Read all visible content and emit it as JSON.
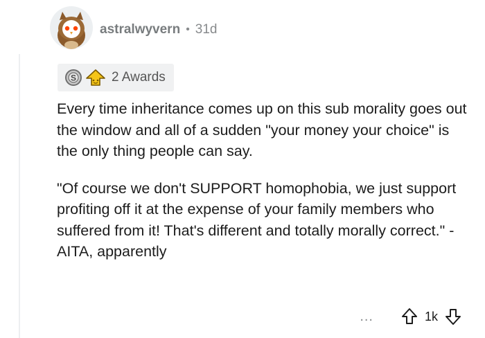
{
  "comment": {
    "author": "astralwyvern",
    "separator": "•",
    "age": "31d",
    "awards_label": "2 Awards",
    "paragraphs": [
      "Every time inheritance comes up on this sub morality goes out the window and all of a sudden \"your money your choice\" is the only thing people can say.",
      "\"Of course we don't SUPPORT homophobia, we just support profiting off it at the expense of your family members who suffered from it! That's different and totally morally correct.\" - AITA, apparently"
    ],
    "score": "1k",
    "more_label": "..."
  },
  "icons": {
    "avatar": "owl-avatar",
    "award_1": "silver-award-icon",
    "award_2": "helpful-award-icon",
    "upvote": "upvote-arrow-icon",
    "downvote": "downvote-arrow-icon"
  },
  "colors": {
    "meta_text": "#787c7e",
    "body_text": "#1c1c1c",
    "awards_bg": "#f0f1f2",
    "helpful_award": "#f5c518"
  }
}
